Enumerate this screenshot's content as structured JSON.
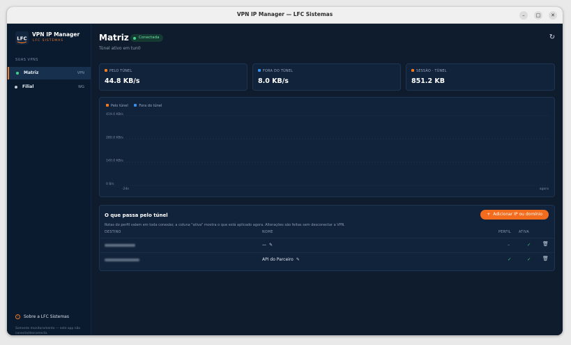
{
  "window": {
    "title": "VPN IP Manager — LFC Sistemas"
  },
  "brand": {
    "name": "VPN IP Manager",
    "subtitle": "LFC SISTEMAS",
    "logo_text": "LFC"
  },
  "sidebar": {
    "section_label": "SUAS VPNS",
    "items": [
      {
        "label": "Matriz",
        "kind": "VPN",
        "active": true,
        "dot_color": "#3fd68a"
      },
      {
        "label": "Filial",
        "kind": "WG",
        "active": false,
        "dot_color": "#c4ccd6"
      }
    ],
    "about_label": "Sobre a LFC Sistemas",
    "footnote": "Somente monitoramento — este app não conecta/desconecta."
  },
  "header": {
    "title": "Matriz",
    "status": "Conectada",
    "subtitle": "Túnel ativo em tun0"
  },
  "stats": [
    {
      "label": "PELO TÚNEL",
      "value": "44.8 KB/s",
      "color": "#f07a24"
    },
    {
      "label": "FORA DO TÚNEL",
      "value": "8.0 KB/s",
      "color": "#3b8ee8"
    },
    {
      "label": "SESSÃO · TÚNEL",
      "value": "851.2 KB",
      "color": "#f07a24"
    }
  ],
  "chart_data": {
    "type": "line",
    "legend": [
      "Pelo túnel",
      "Fora do túnel"
    ],
    "y_tick_labels": [
      "419.0 KB/s",
      "280.0 KB/s",
      "140.0 KB/s",
      "0 B/s"
    ],
    "x_tick_labels": [
      "-24s",
      "agora"
    ],
    "y_unit": "KB/s",
    "ylim": [
      0,
      419
    ],
    "x": [
      -24,
      -23,
      -22,
      -21,
      -20,
      -19,
      -18,
      -17,
      -16,
      -15,
      -14,
      -13,
      -12,
      -11,
      -10,
      -9,
      -8,
      -7,
      -6,
      -5,
      -4,
      -3,
      -2,
      -1,
      0
    ],
    "series": [
      {
        "name": "Pelo túnel",
        "color": "#f07a24",
        "values": [
          0,
          0,
          0,
          0,
          0,
          0,
          0,
          0,
          0,
          0,
          0,
          0,
          0,
          0,
          0,
          0,
          0,
          0,
          0,
          0,
          0,
          0,
          0,
          0,
          0,
          0,
          0,
          0,
          0,
          0,
          0,
          0,
          0,
          0,
          0,
          0,
          0,
          0,
          0,
          0,
          0,
          0,
          0,
          0,
          0,
          0,
          0,
          0,
          0,
          0
        ]
      },
      {
        "name": "Fora do túnel",
        "color": "#3b8ee8",
        "values": [
          0
        ]
      }
    ]
  },
  "routes": {
    "title": "O que passa pelo túnel",
    "description": "Rotas do perfil valem em toda conexão; a coluna \"ativa\" mostra o que está aplicado agora. Alterações são feitas sem desconectar a VPN.",
    "add_label": "Adicionar IP ou domínio",
    "columns": {
      "destino": "DESTINO",
      "nome": "NOME",
      "perfil": "PERFIL",
      "ativa": "ATIVA"
    },
    "rows": [
      {
        "name": "—",
        "perfil": "–",
        "ativa": "✓"
      },
      {
        "name": "API do Parceiro",
        "perfil": "✓",
        "ativa": "✓"
      }
    ]
  }
}
